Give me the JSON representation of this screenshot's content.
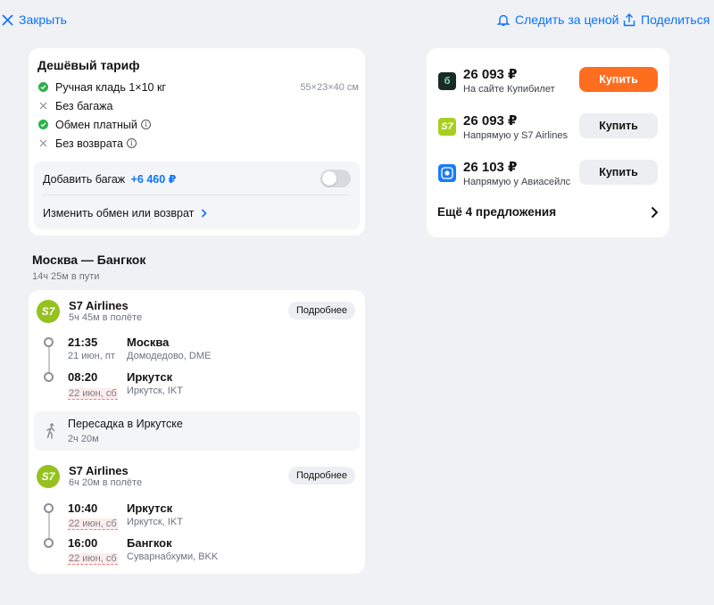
{
  "topbar": {
    "close_label": "Закрыть",
    "follow_price_label": "Следить за ценой",
    "share_label": "Поделиться"
  },
  "tariff": {
    "title": "Дешёвый тариф",
    "features": [
      {
        "label": "Ручная кладь 1×10 кг",
        "extra": "55×23×40 см",
        "status": "included"
      },
      {
        "label": "Без багажа",
        "status": "excluded"
      },
      {
        "label": "Обмен платный",
        "status": "included",
        "info": true
      },
      {
        "label": "Без возврата",
        "status": "excluded",
        "info": true
      }
    ],
    "add_baggage_label": "Добавить багаж",
    "add_baggage_price": "+6 460 ₽",
    "change_label": "Изменить обмен или возврат"
  },
  "offers": {
    "items": [
      {
        "price": "26 093 ₽",
        "seller": "На сайте Купибилет",
        "button": "Купить"
      },
      {
        "price": "26 093 ₽",
        "seller": "Напрямую у S7 Airlines",
        "button": "Купить"
      },
      {
        "price": "26 103 ₽",
        "seller": "Напрямую у Авиасейлс",
        "button": "Купить"
      }
    ],
    "more_label": "Ещё 4 предложения"
  },
  "route": {
    "title": "Москва — Бангкок",
    "duration": "14ч 25м в пути"
  },
  "segments": [
    {
      "airline": "S7 Airlines",
      "logo_text": "S7",
      "flight_time": "5ч 45м в полёте",
      "details_label": "Подробнее",
      "dep_time": "21:35",
      "dep_date": "21 июн, пт",
      "dep_city": "Москва",
      "dep_airport": "Домодедово, DME",
      "arr_time": "08:20",
      "arr_date": "22 июн, сб",
      "arr_city": "Иркутск",
      "arr_airport": "Иркутск, IKT"
    },
    {
      "airline": "S7 Airlines",
      "logo_text": "S7",
      "flight_time": "6ч 20м в полёте",
      "details_label": "Подробнее",
      "dep_time": "10:40",
      "dep_date": "22 июн, сб",
      "dep_city": "Иркутск",
      "dep_airport": "Иркутск, IKT",
      "arr_time": "16:00",
      "arr_date": "22 июн, сб",
      "arr_city": "Бангкок",
      "arr_airport": "Суварнабхуми, BKK"
    }
  ],
  "transfer": {
    "label": "Пересадка в Иркутске",
    "duration": "2ч 20м"
  },
  "colors": {
    "accent_blue": "#0c73fe",
    "buy_orange": "#ff6d1f",
    "s7_green": "#96c11f",
    "check_green": "#2bb24c"
  }
}
